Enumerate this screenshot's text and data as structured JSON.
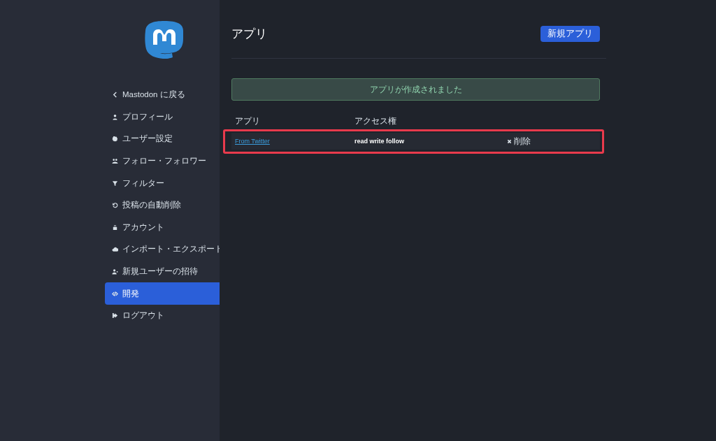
{
  "sidebar": {
    "items": [
      {
        "label": "Mastodon に戻る",
        "kind": "back",
        "selected": false
      },
      {
        "label": "プロフィール",
        "kind": "profile",
        "selected": false
      },
      {
        "label": "ユーザー設定",
        "kind": "settings",
        "selected": false
      },
      {
        "label": "フォロー・フォロワー",
        "kind": "follows",
        "selected": false
      },
      {
        "label": "フィルター",
        "kind": "filter",
        "selected": false
      },
      {
        "label": "投稿の自動削除",
        "kind": "history",
        "selected": false
      },
      {
        "label": "アカウント",
        "kind": "lock",
        "selected": false
      },
      {
        "label": "インポート・エクスポート",
        "kind": "cloud",
        "selected": false
      },
      {
        "label": "新規ユーザーの招待",
        "kind": "invite",
        "selected": false
      },
      {
        "label": "開発",
        "kind": "code",
        "selected": true
      },
      {
        "label": "ログアウト",
        "kind": "logout",
        "selected": false
      }
    ]
  },
  "page": {
    "title": "アプリ",
    "new_button": "新規アプリ"
  },
  "alert": {
    "message": "アプリが作成されました"
  },
  "table": {
    "columns": [
      "アプリ",
      "アクセス権"
    ],
    "rows": [
      {
        "app": "From Twitter",
        "scopes": "read write follow",
        "delete": "削除",
        "highlighted": true
      }
    ]
  }
}
